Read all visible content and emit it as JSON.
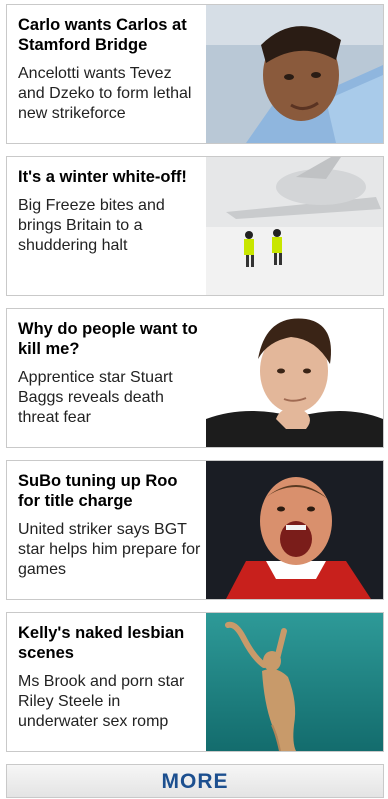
{
  "stories": [
    {
      "headline": "Carlo wants Carlos at Stamford Bridge",
      "summary": "Ancelotti wants Tevez and Dzeko to form lethal new strikeforce",
      "image_icon": "footballer-sky-blue-shirt-photo"
    },
    {
      "headline": "It's a winter white-off!",
      "summary": "Big Freeze bites and brings Britain to a shuddering halt",
      "image_icon": "snowy-airport-plane-photo"
    },
    {
      "headline": "Why do people want to kill me?",
      "summary": "Apprentice star Stuart Baggs reveals death threat fear",
      "image_icon": "man-hand-on-chin-portrait-photo"
    },
    {
      "headline": "SuBo tuning up Roo for title charge",
      "summary": "United striker says BGT star helps him prepare for games",
      "image_icon": "footballer-shouting-red-shirt-photo"
    },
    {
      "headline": "Kelly's naked lesbian scenes",
      "summary": "Ms Brook and porn star Riley Steele in underwater sex romp",
      "image_icon": "underwater-figure-photo"
    }
  ],
  "more_label": "MORE"
}
